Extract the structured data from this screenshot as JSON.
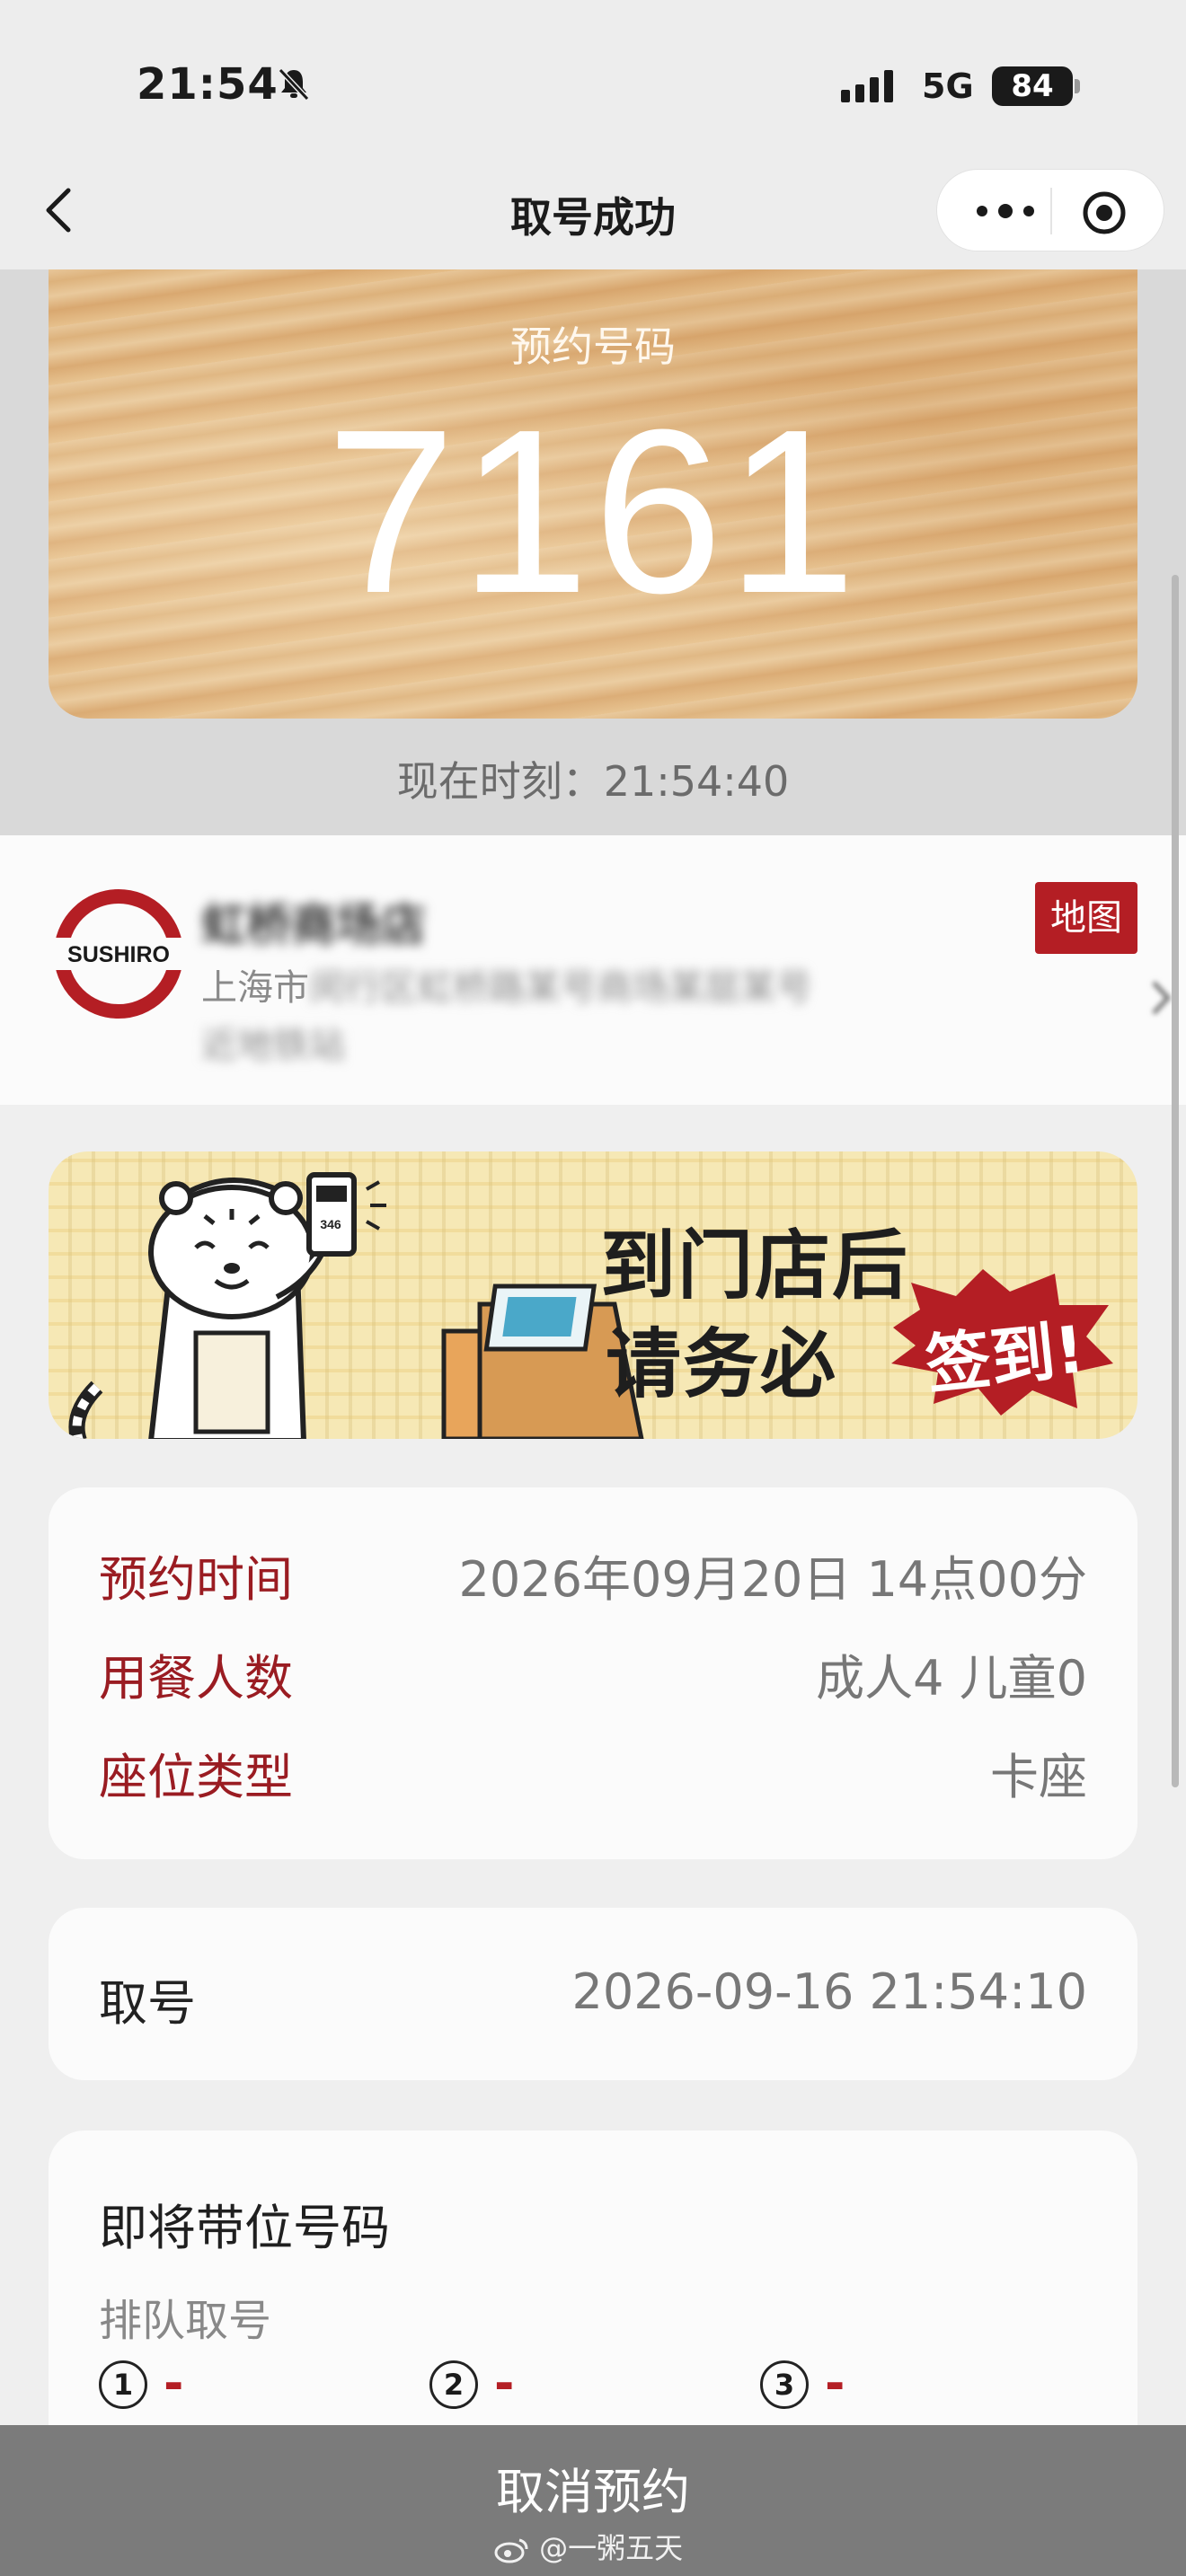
{
  "status_bar": {
    "time": "21:54",
    "network": "5G",
    "battery": "84"
  },
  "nav": {
    "title": "取号成功"
  },
  "reservation": {
    "label": "预约号码",
    "number": "7161",
    "current_time": "现在时刻：21:54:40"
  },
  "store": {
    "logo_text": "SUSHIRO",
    "name": "虹桥商场店",
    "address_prefix": "上海市",
    "address_rest": "闵行区虹桥路某号商场某层某号",
    "address_line2": "近地铁站",
    "map_label": "地图"
  },
  "banner": {
    "line1": "到门店后",
    "line2": "请务必",
    "burst": "签到!",
    "phone_number": "346"
  },
  "details": [
    {
      "label": "预约时间",
      "value": "2026年09月20日 14点00分"
    },
    {
      "label": "用餐人数",
      "value": "成人4 儿童0"
    },
    {
      "label": "座位类型",
      "value": "卡座"
    }
  ],
  "ticket": {
    "label": "取号",
    "value": "2026-09-16 21:54:10"
  },
  "queue": {
    "title": "即将带位号码",
    "subtitle": "排队取号",
    "items": [
      {
        "index": "1",
        "value": "---"
      },
      {
        "index": "2",
        "value": "---"
      },
      {
        "index": "3",
        "value": "---"
      }
    ]
  },
  "bottom": {
    "cancel_label": "取消预约",
    "watermark": "@一粥五天"
  },
  "colors": {
    "accent_red": "#b41e24",
    "bottom_bar": "#7b7b7b"
  }
}
